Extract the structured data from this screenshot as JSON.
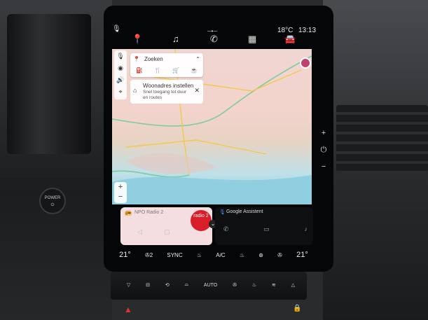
{
  "status": {
    "mic_icon": "mic-icon",
    "temperature": "18°C",
    "time": "13:13"
  },
  "top_nav": [
    "navigation-icon",
    "music-icon",
    "phone-icon",
    "apps-icon",
    "car-icon"
  ],
  "map": {
    "search_label": "Zoeken",
    "shortcuts": [
      "fuel-icon",
      "restaurant-icon",
      "shopping-icon",
      "coffee-icon"
    ],
    "home_title": "Woonadres instellen",
    "home_sub": "Snel toegang tot duur en routes",
    "side_icons": [
      "mic-icon",
      "layers-icon",
      "volume-icon",
      "compass-icon"
    ],
    "zoom_in": "+",
    "zoom_out": "−"
  },
  "radio": {
    "label": "NPO Radio 2",
    "logo_text": "radio 2"
  },
  "assistant": {
    "label": "Google Assistent"
  },
  "climate": {
    "left_temp": "21°",
    "fan_level": "2",
    "sync": "SYNC",
    "ac": "A/C",
    "right_temp": "21°"
  },
  "panel": {
    "auto": "AUTO"
  },
  "power": {
    "label": "POWER"
  }
}
